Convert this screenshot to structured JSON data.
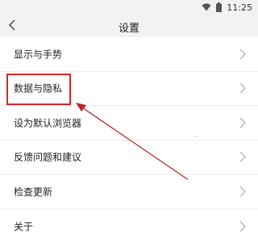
{
  "status_bar": {
    "time": "11:25"
  },
  "header": {
    "title": "设置",
    "back_icon": "chevron-left-icon"
  },
  "menu": {
    "items": [
      {
        "label": "显示与手势"
      },
      {
        "label": "数据与隐私"
      },
      {
        "label": "设为默认浏览器"
      },
      {
        "label": "反馈问题和建议"
      },
      {
        "label": "检查更新"
      },
      {
        "label": "关于"
      }
    ],
    "chevron_icon": "chevron-right-icon"
  },
  "annotation": {
    "highlight_target": "数据与隐私",
    "color": "#d9262c"
  }
}
